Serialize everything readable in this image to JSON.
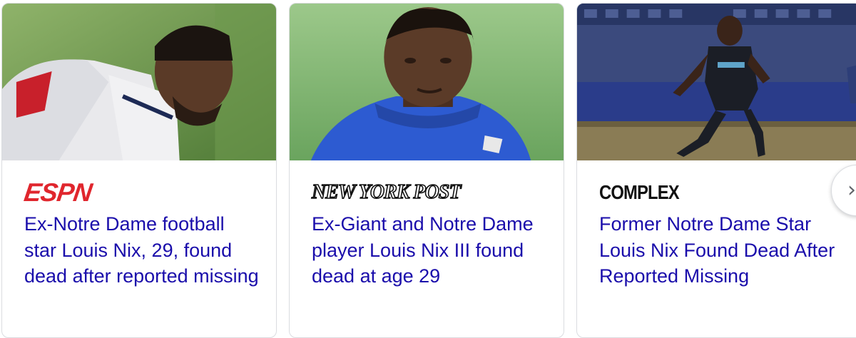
{
  "cards": [
    {
      "source": "ESPN",
      "headline": "Ex-Notre Dame football star Louis Nix, 29, found dead after reported missing"
    },
    {
      "source": "NEW YORK POST",
      "headline": "Ex-Giant and Notre Dame player Louis Nix III found dead at age 29"
    },
    {
      "source": "COMPLEX",
      "headline": "Former Notre Dame Star Louis Nix Found Dead After Reported Missing"
    }
  ],
  "colors": {
    "link": "#1a0dab",
    "espn_red": "#e0262d",
    "border": "#dadce0"
  },
  "controls": {
    "next_glyph": "›"
  }
}
